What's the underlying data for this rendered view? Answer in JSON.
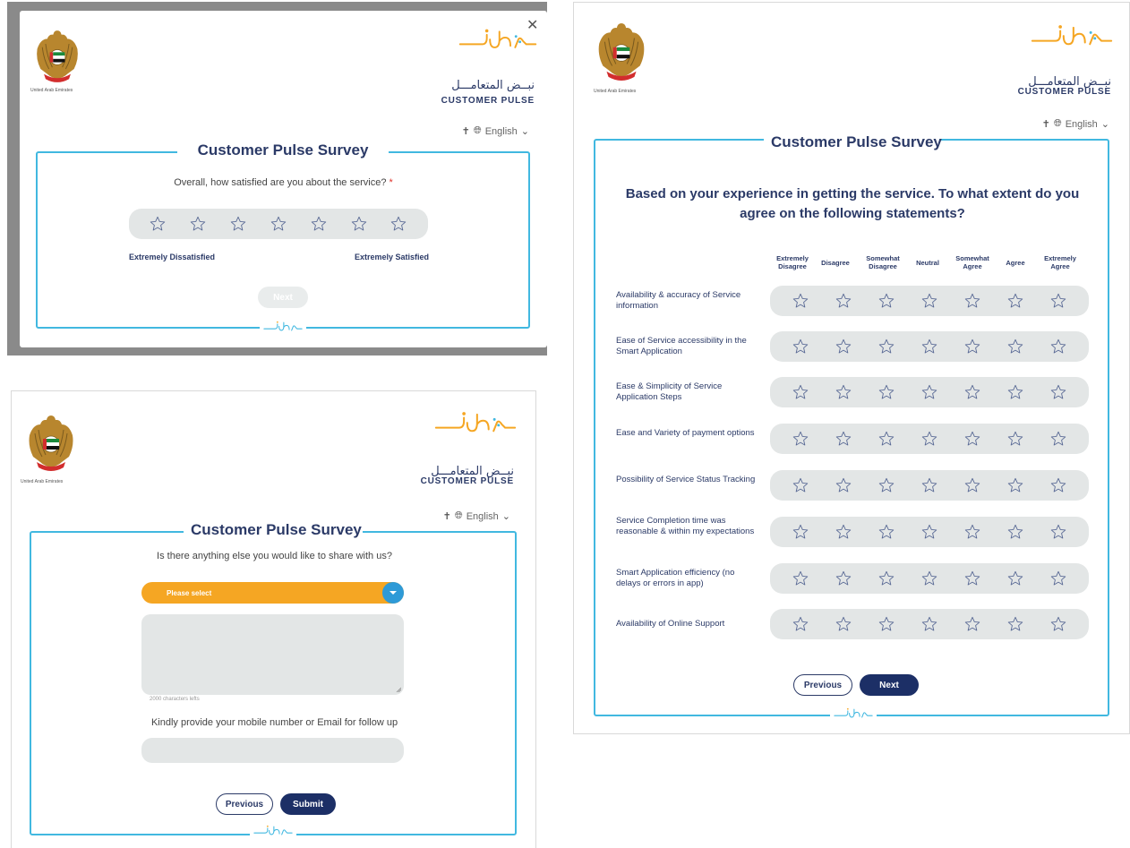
{
  "common": {
    "emblem_caption": "United Arab Emirates",
    "logo_arabic": "نبــض المتعامـــل",
    "logo_english": "CUSTOMER PULSE",
    "language": "English",
    "survey_title": "Customer Pulse Survey",
    "colors": {
      "navy": "#2b3a67",
      "cyan": "#41b8e0",
      "orange": "#f5a623",
      "blue": "#2e9ad7"
    }
  },
  "panel1": {
    "question": "Overall, how satisfied are you about the service?",
    "required_mark": "*",
    "scale_min": "Extremely Dissatisfied",
    "scale_max": "Extremely Satisfied",
    "next": "Next",
    "stars": 7
  },
  "panel2": {
    "question": "Based on your experience in getting the service. To what extent do you agree on the following statements?",
    "columns": [
      "Extremely\nDisagree",
      "Disagree",
      "Somewhat\nDisagree",
      "Neutral",
      "Somewhat\nAgree",
      "Agree",
      "Extremely\nAgree"
    ],
    "rows": [
      "Availability & accuracy of Service information",
      "Ease of Service accessibility in the Smart Application",
      "Ease & Simplicity of Service Application Steps",
      "Ease and Variety of payment options",
      "Possibility of Service Status Tracking",
      "Service Completion time was reasonable & within my expectations",
      "Smart Application efficiency (no delays or errors in app)",
      "Availability of Online Support"
    ],
    "previous": "Previous",
    "next": "Next"
  },
  "panel3": {
    "question": "Is there anything else you would like to share with us?",
    "select_placeholder": "Please select",
    "chars_left": "2000 characters lefts",
    "followup": "Kindly provide your mobile number or Email for follow up",
    "previous": "Previous",
    "submit": "Submit"
  }
}
